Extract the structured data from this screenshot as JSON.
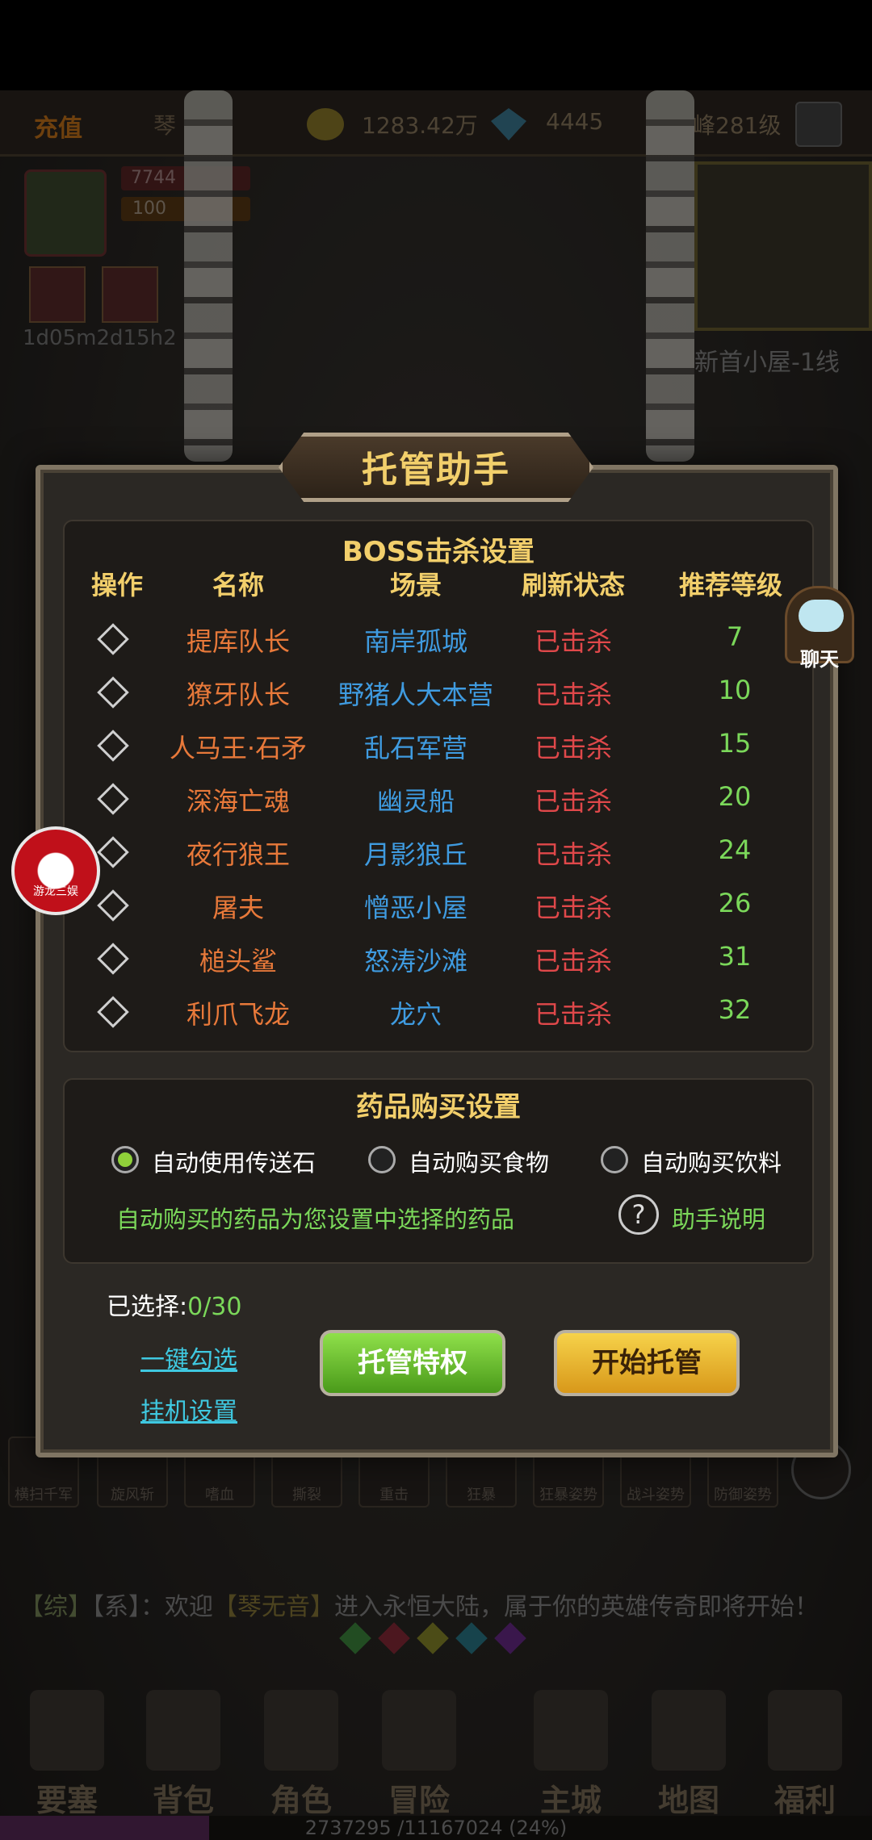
{
  "topbar": {
    "recharge": "充值",
    "player_name": "琴",
    "gold": "1283.42万",
    "gems": "4445",
    "level": "峰281级"
  },
  "status": {
    "hp": "7744",
    "mp": "100",
    "timer": "1d05m2d15h2"
  },
  "map": {
    "name": "新首小屋-1线"
  },
  "chat_button": {
    "label": "聊天"
  },
  "logo_badge": {
    "label": "游龙三娱"
  },
  "modal": {
    "title": "托管助手",
    "boss_section": {
      "title": "BOSS击杀设置",
      "headers": [
        "操作",
        "名称",
        "场景",
        "刷新状态",
        "推荐等级"
      ],
      "rows": [
        {
          "name": "提库队长",
          "scene": "南岸孤城",
          "state": "已击杀",
          "level": "7"
        },
        {
          "name": "獠牙队长",
          "scene": "野猪人大本营",
          "state": "已击杀",
          "level": "10"
        },
        {
          "name": "人马王·石矛",
          "scene": "乱石军营",
          "state": "已击杀",
          "level": "15"
        },
        {
          "name": "深海亡魂",
          "scene": "幽灵船",
          "state": "已击杀",
          "level": "20"
        },
        {
          "name": "夜行狼王",
          "scene": "月影狼丘",
          "state": "已击杀",
          "level": "24"
        },
        {
          "name": "屠夫",
          "scene": "憎恶小屋",
          "state": "已击杀",
          "level": "26"
        },
        {
          "name": "槌头鲨",
          "scene": "怒涛沙滩",
          "state": "已击杀",
          "level": "31"
        },
        {
          "name": "利爪飞龙",
          "scene": "龙穴",
          "state": "已击杀",
          "level": "32"
        }
      ]
    },
    "potion_section": {
      "title": "药品购买设置",
      "options": [
        "自动使用传送石",
        "自动购买食物",
        "自动购买饮料"
      ],
      "selected_option": "自动使用传送石",
      "note": "自动购买的药品为您设置中选择的药品",
      "help_symbol": "?",
      "help_label": "助手说明"
    },
    "selected_label": "已选择:",
    "selected_count": "0/30",
    "select_all_link": "一键勾选",
    "afk_settings_link": "挂机设置",
    "privilege_button": "托管特权",
    "start_button": "开始托管"
  },
  "skills": [
    "横扫千军",
    "旋风斩",
    "嗜血",
    "撕裂",
    "重击",
    "狂暴",
    "狂暴姿势",
    "战斗姿势",
    "防御姿势"
  ],
  "chat_log": {
    "tag1": "【综】",
    "tag2": "【系】",
    "colon": "：",
    "text1": "欢迎",
    "player": "【琴无音】",
    "text2": "进入永恒大陆，属于你的英雄传奇即将开始！"
  },
  "nav": [
    "要塞",
    "背包",
    "角色",
    "冒险",
    "主城",
    "地图",
    "福利"
  ],
  "exp": {
    "text": "2737295 /11167024 (24%)",
    "fraction": 0.24
  },
  "colors": {
    "gold": "#f2cf6b",
    "boss_name": "#e8793a",
    "scene": "#3f9be0",
    "killed": "#e0484a",
    "level": "#7bd85a"
  }
}
